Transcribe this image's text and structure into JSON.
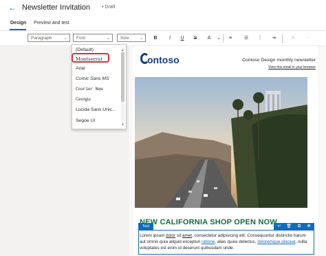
{
  "header": {
    "back_icon": "arrow-left-icon",
    "title": "Newsletter Invitation",
    "status": "Draft"
  },
  "tabs": [
    {
      "label": "Design",
      "active": true
    },
    {
      "label": "Preview and test",
      "active": false
    }
  ],
  "toolbar": {
    "paragraph": "Paragraph",
    "font": "Font",
    "size": "Size",
    "bold": "B",
    "italic": "I",
    "underline": "U",
    "strike": "S"
  },
  "font_menu": {
    "options": [
      "(Default)",
      "Montserrat",
      "Arial",
      "Comic Sans MS",
      "Courier New",
      "Georgia",
      "Lucida Sans Unic...",
      "Segoe UI"
    ],
    "highlighted": "Montserrat"
  },
  "email": {
    "logo": "ontoso",
    "newsletter_title": "Contoso Design monthly newsletter",
    "browser_link": "View this email in your browser",
    "headline": "NEW CALIFORNIA SHOP OPEN NOW",
    "text_badge": "Text",
    "body_parts": [
      "Lorem ipsum ",
      "dolor",
      " sit ",
      "amet",
      ", consectetur adipisicing elit. Consequuntur distinctio harum aut omnis quia aliquid excepturi ",
      "ratione",
      ", alias quasi delectus, ",
      "doloremque placeat",
      ", nulla voluptates est enim id deserunt quibusdam unde."
    ]
  },
  "colors": {
    "accent": "#0f6cbd",
    "headline": "#0f6e3d",
    "highlight_ring": "#d13438"
  }
}
